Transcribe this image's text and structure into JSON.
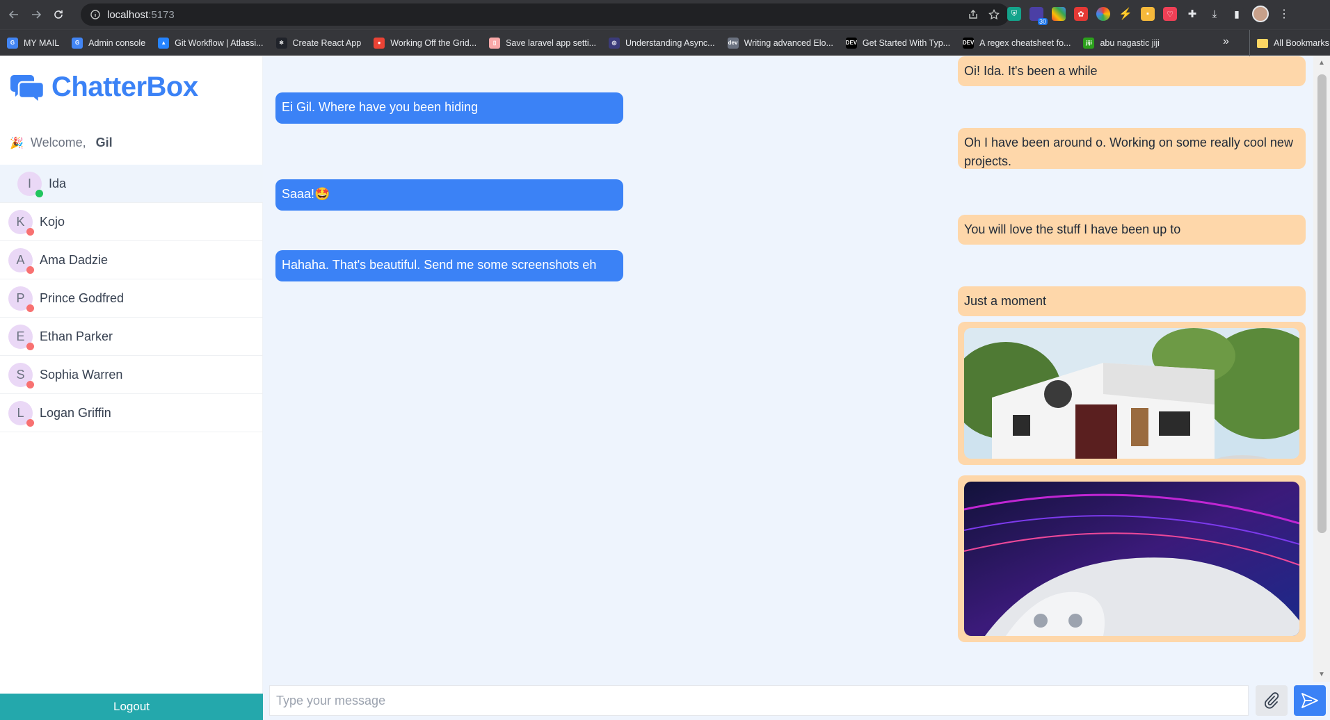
{
  "browser": {
    "url_host": "localhost",
    "url_port": ":5173",
    "extension_badge": "30",
    "bookmarks": [
      {
        "label": "MY MAIL",
        "color": "#4285f4",
        "glyph": "G"
      },
      {
        "label": "Admin console",
        "color": "#4285f4",
        "glyph": "G"
      },
      {
        "label": "Git Workflow | Atlassi...",
        "color": "#2684ff",
        "glyph": "▲"
      },
      {
        "label": "Create React App",
        "color": "#20232a",
        "glyph": "⚛"
      },
      {
        "label": "Working Off the Grid...",
        "color": "#ea4335",
        "glyph": "●"
      },
      {
        "label": "Save laravel app setti...",
        "color": "#f9a8a8",
        "glyph": "▯"
      },
      {
        "label": "Understanding Async...",
        "color": "#3b3b7a",
        "glyph": "◎"
      },
      {
        "label": "Writing advanced Elo...",
        "color": "#6b7280",
        "glyph": "dev"
      },
      {
        "label": "Get Started With Typ...",
        "color": "#000000",
        "glyph": "DEV"
      },
      {
        "label": "A regex cheatsheet fo...",
        "color": "#000000",
        "glyph": "DEV"
      },
      {
        "label": "abu nagastic jiji",
        "color": "#2ca01c",
        "glyph": "jiji"
      }
    ],
    "more_label": "»",
    "all_bookmarks": "All Bookmarks"
  },
  "app": {
    "brand": "ChatterBox",
    "welcome_label": "Welcome,",
    "party_emoji": "🎉",
    "user_name": "Gil",
    "logout_label": "Logout"
  },
  "contacts": [
    {
      "initial": "I",
      "name": "Ida",
      "online": true
    },
    {
      "initial": "K",
      "name": "Kojo",
      "online": false
    },
    {
      "initial": "A",
      "name": "Ama Dadzie",
      "online": false
    },
    {
      "initial": "P",
      "name": "Prince Godfred",
      "online": false
    },
    {
      "initial": "E",
      "name": "Ethan Parker",
      "online": false
    },
    {
      "initial": "S",
      "name": "Sophia Warren",
      "online": false
    },
    {
      "initial": "L",
      "name": "Logan Griffin",
      "online": false
    }
  ],
  "colors": {
    "online": "#22c55e",
    "offline": "#f87171",
    "incoming_bubble": "#3b82f6",
    "outgoing_bubble": "#fed7aa"
  },
  "messages": [
    {
      "direction": "out",
      "text": "Oi! Ida. It's been a while"
    },
    {
      "direction": "in",
      "text": "Ei Gil. Where have you been hiding"
    },
    {
      "direction": "out",
      "text": "Oh I have been around o. Working on some really cool new projects."
    },
    {
      "direction": "in",
      "text": "Saaa!🤩"
    },
    {
      "direction": "out",
      "text": "You will love the stuff I have been up to"
    },
    {
      "direction": "in",
      "text": "Hahaha. That's beautiful. Send me some screenshots eh"
    },
    {
      "direction": "out",
      "text": "Just a moment"
    },
    {
      "direction": "out",
      "type": "image",
      "alt": "modern-house-photo"
    },
    {
      "direction": "out",
      "type": "image",
      "alt": "game-console-photo"
    }
  ],
  "composer": {
    "placeholder": "Type your message",
    "value": ""
  }
}
